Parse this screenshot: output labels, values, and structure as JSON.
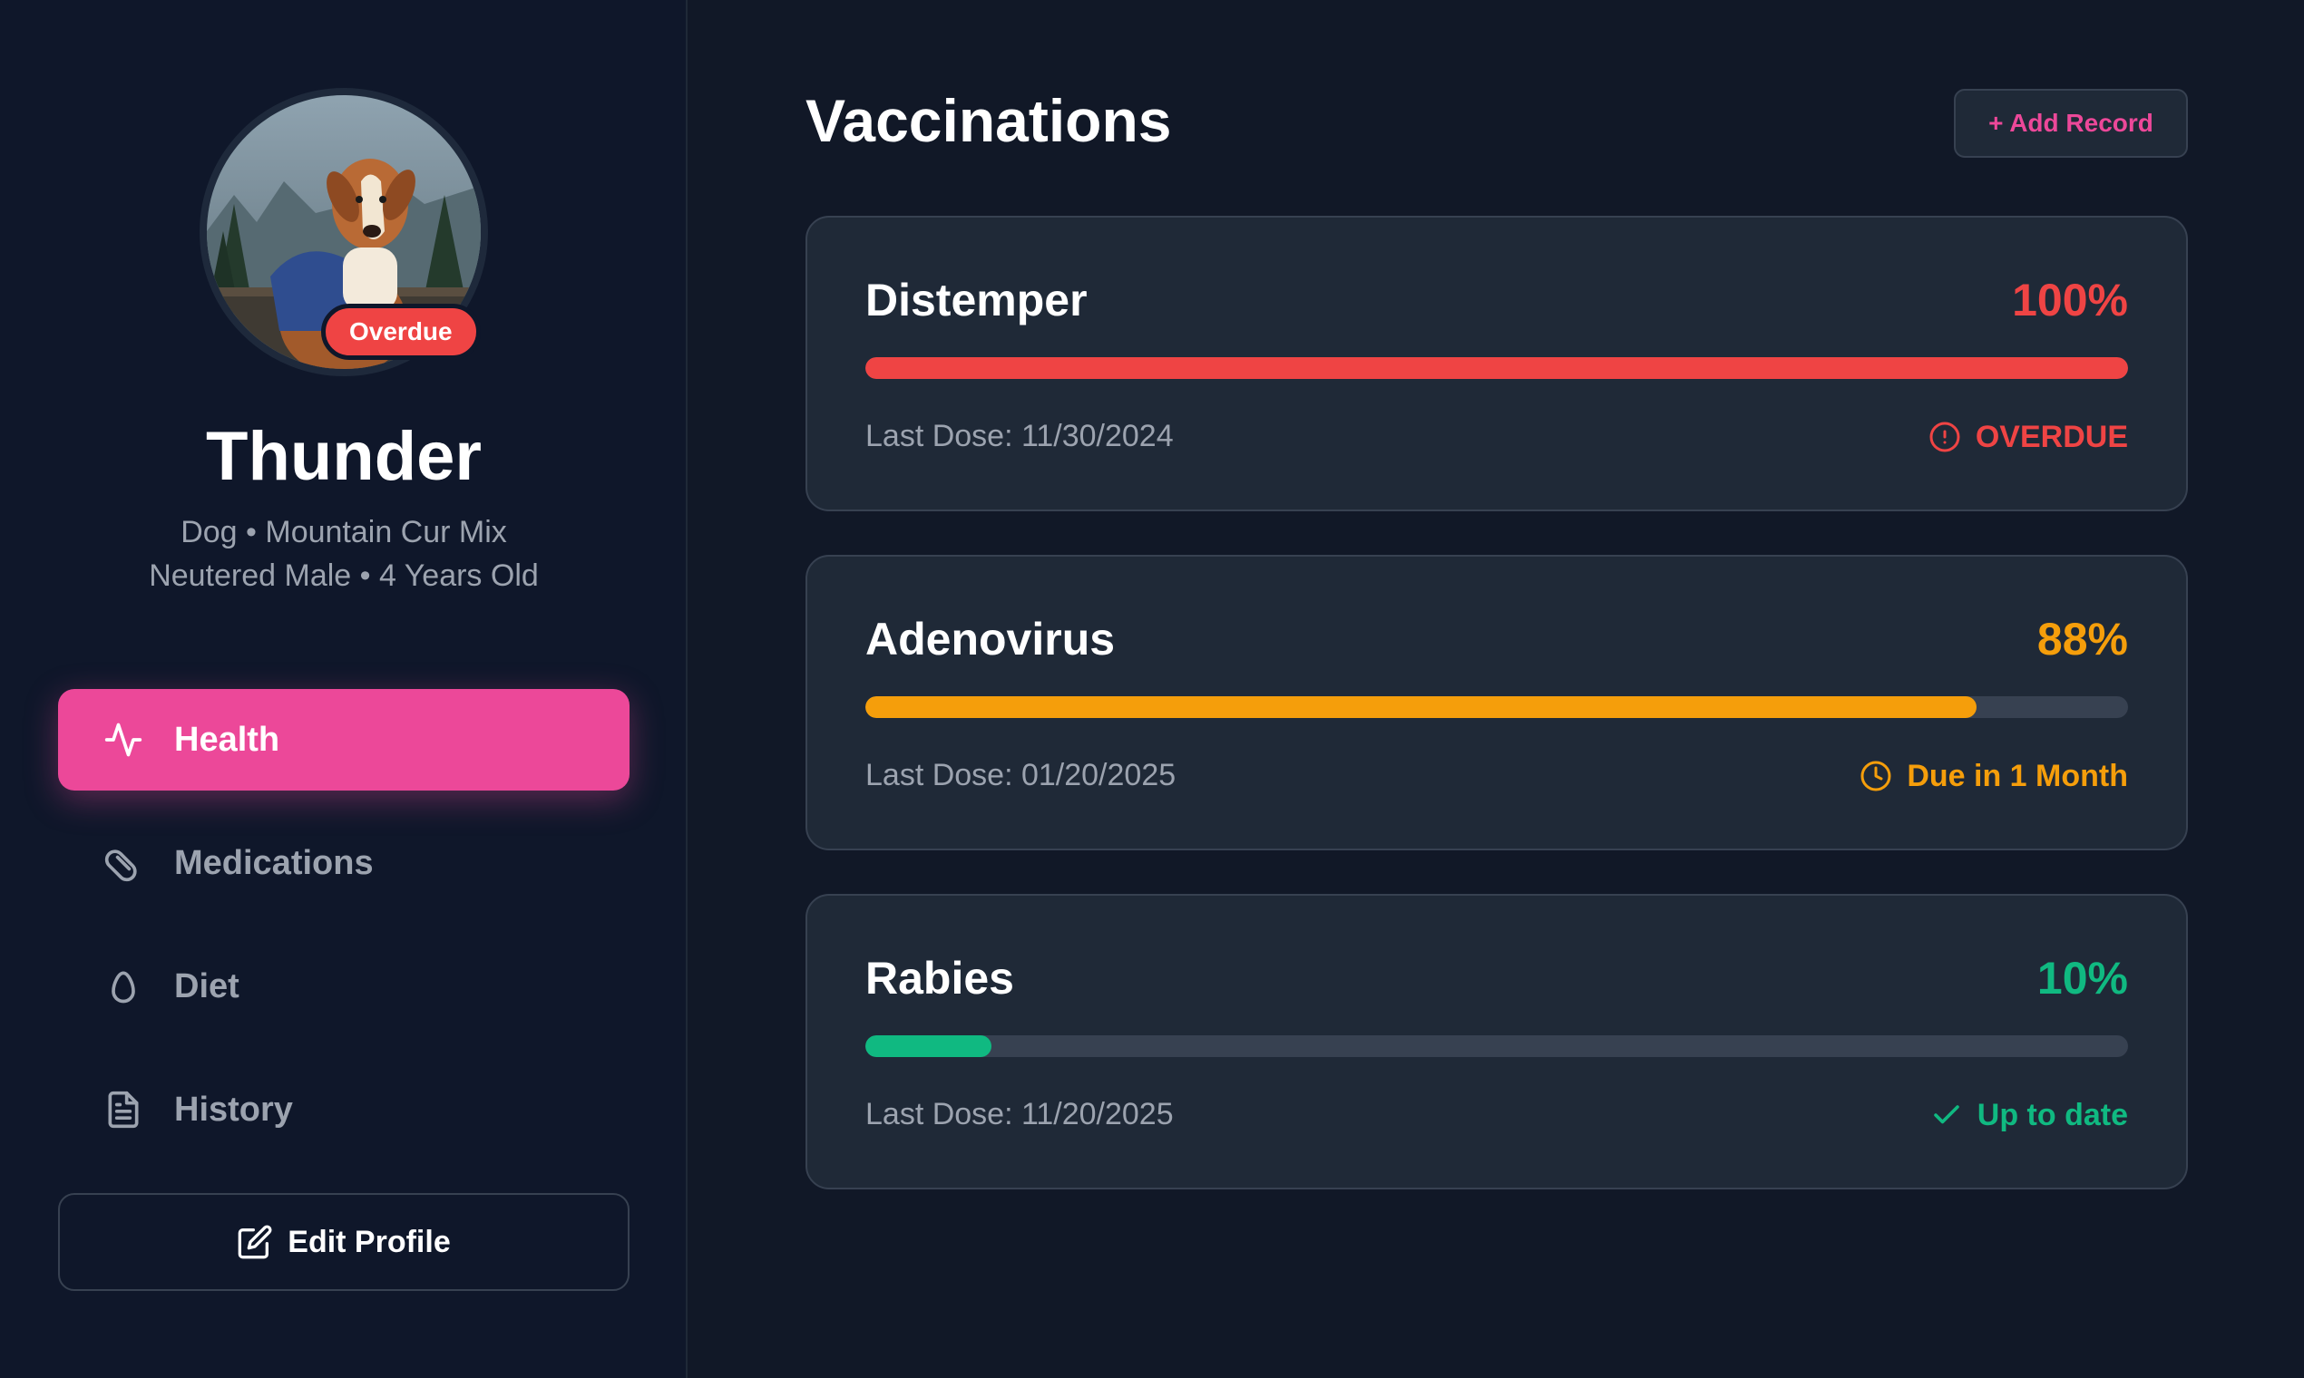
{
  "pet": {
    "name": "Thunder",
    "line1": "Dog • Mountain Cur Mix",
    "line2": "Neutered Male • 4 Years Old",
    "badge": "Overdue",
    "badge_color": "#ef4444"
  },
  "nav": {
    "items": [
      {
        "label": "Health",
        "icon": "activity-icon",
        "active": true
      },
      {
        "label": "Medications",
        "icon": "pill-icon",
        "active": false
      },
      {
        "label": "Diet",
        "icon": "egg-icon",
        "active": false
      },
      {
        "label": "History",
        "icon": "file-text-icon",
        "active": false
      }
    ],
    "edit_label": "Edit Profile"
  },
  "main": {
    "title": "Vaccinations",
    "add_label": "+ Add Record",
    "vaccines": [
      {
        "name": "Distemper",
        "percent_label": "100%",
        "progress": 1.0,
        "last_dose": "Last Dose: 11/30/2024",
        "status": "OVERDUE",
        "status_icon": "alert-circle-icon",
        "color": "#ef4444"
      },
      {
        "name": "Adenovirus",
        "percent_label": "88%",
        "progress": 0.88,
        "last_dose": "Last Dose: 01/20/2025",
        "status": "Due in 1 Month",
        "status_icon": "clock-icon",
        "color": "#f59e0b"
      },
      {
        "name": "Rabies",
        "percent_label": "10%",
        "progress": 0.1,
        "last_dose": "Last Dose: 11/20/2025",
        "status": "Up to date",
        "status_icon": "check-icon",
        "color": "#10b981"
      }
    ]
  },
  "colors": {
    "accent": "#ec4899",
    "background": "#111827",
    "sidebar": "#0f172a",
    "card": "#1f2937"
  }
}
